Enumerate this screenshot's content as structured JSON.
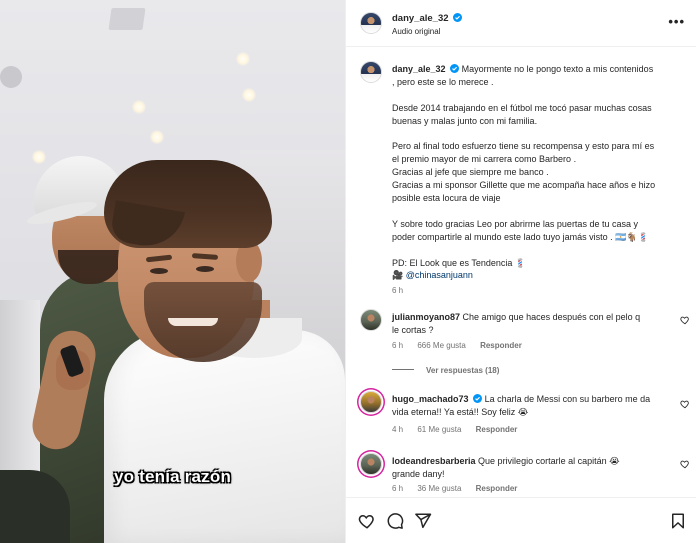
{
  "video": {
    "caption": "yo tenía razón"
  },
  "header": {
    "username": "dany_ale_32",
    "subtitle": "Audio original",
    "more_label": "•••"
  },
  "post": {
    "username": "dany_ale_32",
    "first_line": "Mayormente no le pongo texto a mis contenidos",
    "second_line": ", pero este se lo merece .",
    "paragraphs": [
      [
        "Desde 2014 trabajando en el fútbol me tocó pasar muchas cosas",
        "buenas y malas junto con mi familia."
      ],
      [
        "Pero al final todo esfuerzo tiene su recompensa y esto para mí es",
        "el premio mayor de mi carrera como Barbero .",
        "Gracias al jefe que siempre me banco .",
        "Gracias a mi sponsor Gillette que me acompaña hace años e hizo",
        "posible esta locura de viaje"
      ],
      [
        "Y sobre todo gracias Leo por abrirme las puertas de tu casa y",
        "poder compartirle al mundo este lado tuyo jamás visto . 🇦🇷🐐💈"
      ]
    ],
    "pd_line": "PD: El Look que es Tendencia 💈",
    "mention": "@chinasanjuann",
    "time": "6 h"
  },
  "comments": [
    {
      "username": "julianmoyano87",
      "lines": [
        "Che amigo que haces después con el pelo q",
        "le cortas ?"
      ],
      "verified": false,
      "time": "6 h",
      "likes": "666 Me gusta",
      "reply_label": "Responder",
      "view_replies": "Ver respuestas (18)"
    },
    {
      "username": "hugo_machado73",
      "lines": [
        "La charla de Messi con su barbero me da",
        "vida eterna!! Ya está!! Soy feliz 😭"
      ],
      "verified": true,
      "time": "4 h",
      "likes": "61 Me gusta",
      "reply_label": "Responder"
    },
    {
      "username": "lodeandresbarberia",
      "lines": [
        "Que privilegio cortarle al capitán 😭",
        "grande dany!"
      ],
      "verified": false,
      "time": "6 h",
      "likes": "36 Me gusta",
      "reply_label": "Responder"
    }
  ],
  "icons": {
    "verified": "verified-badge-icon",
    "like": "heart-icon",
    "comment": "comment-icon",
    "share": "share-icon",
    "save": "bookmark-icon"
  },
  "colors": {
    "verified": "#0095f6",
    "text": "#262626",
    "muted": "#737373",
    "link": "#00376b",
    "story_ring": "#d6249f"
  }
}
